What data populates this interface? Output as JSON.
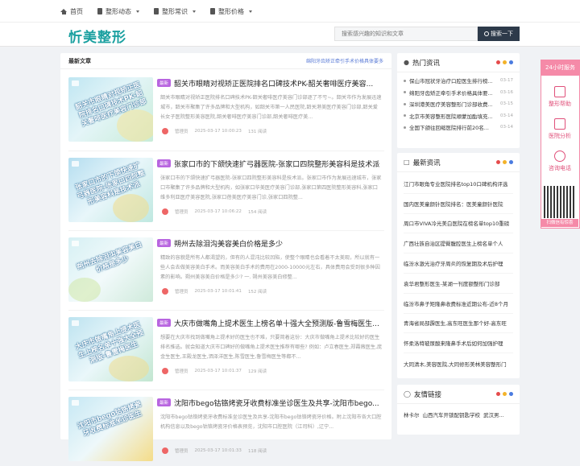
{
  "topnav": [
    {
      "label": "首页",
      "icon": "home-icon",
      "dropdown": false
    },
    {
      "label": "整形动态",
      "icon": "book-icon",
      "dropdown": true
    },
    {
      "label": "整形常识",
      "icon": "book-icon",
      "dropdown": true
    },
    {
      "label": "整形价格",
      "icon": "book-icon",
      "dropdown": true
    }
  ],
  "logo": "忻美整形",
  "search": {
    "placeholder": "搜索感兴趣的知识和文章",
    "button": "搜索一下"
  },
  "main": {
    "heading": "最新文章",
    "notice": "绵阳牙齿矫正牵引手术价格具体要多",
    "articles": [
      {
        "badge": "最新",
        "title": "韶关市眼睛对视矫正医院排名口碑技术PK-韶关奢啡医疗美容...",
        "thumb_text": "韶关市眼睛对视矫正医院排名口碑技术PK-韶关奢啡医疗美容门诊部",
        "excerpt": "韶关市眼睛对视矫正医院排名口碑技术PK-韶关奢啡医疗美容门诊部逐了不亏~。韶关市作为发展迅速城市，韶关市聚集了许多品牌和大型机构，如韶关市第一人民医院,韶关港美医疗美容门诊部,韶关爱长女子医院整形美容医院,韶关奢啡医疗美容门诊部,韶关奢啡医疗美...",
        "author": "管理员",
        "date": "2025-03-17 10:00:23",
        "views": "131 阅读"
      },
      {
        "badge": "最新",
        "title": "张家口市的下颌快速扩弓器医院-张家口四院整形美容科是技术派",
        "thumb_text": "张家口市的下颌快速扩弓器医院-张家口四院整形美容科是技术派",
        "excerpt": "张家口市的下颌快速扩弓器医院-张家口四院整形美容科是技术派。张家口市作为发展迅速城市，张家口市聚集了许多品牌和大型机构，如张家口华美医疗美容门诊部,张家口第四医院整形美容科,张家口维多利亚医疗美容医院,张家口蓓美医疗美容门诊,张家口四院整...",
        "author": "管理员",
        "date": "2025-03-17 10:06:22",
        "views": "154 阅读"
      },
      {
        "badge": "最新",
        "title": "朔州去除泪沟美容美白价格是多少",
        "thumb_text": "朔州去除泪沟美容美白价格是多少",
        "excerpt": "精致的容貌是所有人都渴望的，但有的人混沌比较凹陷，使整个眼睛也会看着不太美观，所以就有一些人会去做美容美白手术。而美容美白手术的费用在2000-10000元左右，具体费用会受到很多种因素的影响。朔州美容美白价格是多少? 一. 朔州美容美白修整...",
        "author": "管理员",
        "date": "2025-03-17 10:01:41",
        "views": "152 阅读"
      },
      {
        "badge": "最新",
        "title": "大庆市做嘴角上提术医生上榜名单十强大全预测版-鲁雪梅医生...",
        "thumb_text": "大庆市做嘴角上提术医生上榜名单十强大全预测版-鲁雪梅医生",
        "excerpt": "想要在大庆市找到做嘴角上提术好的医生也不难，只要简着这份：大庆市做嘴角上提术比较好的医生排名推选。就会知道大庆市口碑好的做嘴角上提术医生推荐有哪些? 例如：卢立春医生,郑霞薇医生,庞金生医生,王殿龙医生,洒泽洋医生,陈雪医生,鲁雪梅医生等都不...",
        "author": "管理员",
        "date": "2025-03-17 10:01:37",
        "views": "129 阅读"
      },
      {
        "badge": "最新",
        "title": "沈阳市bego钴铬烤瓷牙收费标准坐诊医生及共享-沈阳市bego...",
        "thumb_text": "沈阳市bego钴铬烤瓷牙收费标准坐诊医生",
        "excerpt": "沈阳市bego钴铬烤瓷牙收费标准坐诊医生及共享-沈阳市bego钴铬烤瓷牙价格。附上沈阳市各大口腔机构信息以及bego钴铬烤瓷牙价格表预览，沈阳市口腔医院（江司科）,辽宁...",
        "author": "管理员",
        "date": "2025-03-17 10:01:33",
        "views": "118 阅读"
      }
    ]
  },
  "hot": {
    "title": "热门资讯",
    "items": [
      {
        "text": "保山市冠状牙治疗口腔医生排行榜...",
        "date": "03-17"
      },
      {
        "text": "绵阳牙齿矫正牵引手术价格具体要...",
        "date": "03-16"
      },
      {
        "text": "深圳港美医疗美容整形门诊部收费...",
        "date": "03-15"
      },
      {
        "text": "北京市美容整形医院顺蒙加酯填充...",
        "date": "03-14"
      },
      {
        "text": "全国下颌往回缩医院排行前20名...",
        "date": "03-14"
      }
    ]
  },
  "latest": {
    "title": "最新资讯",
    "items": [
      "江门市眼角专业医院排名top10口碑机构评选",
      "国内医美童颜针医院排名：医美童颜针医院",
      "周口市VIVA冷光美白医院在榜名单top10重磅",
      "广西壮族自治区提臀腹腔医生上榜名单个人",
      "临汾水激光治疗牙周炎的恢复期及术后护理",
      "袁华君整形医生-某湖一刊度额整形门诊部",
      "临汾市鼻子矩隆鼻收费标准近期公布-近8个月",
      "青海省局部霹医生,高东旺医生那个好-高东旺",
      "怀柔洛特玻尿酸来隆鼻手术后如何加强护理",
      "大同清木,美容医院,大同修形美林美容整形门"
    ]
  },
  "friends": {
    "title": "友情链接",
    "items": [
      "林卡尔",
      "山西汽车开锁配钥匙学校",
      "武汉男..."
    ]
  },
  "float": {
    "call": "24小时服务",
    "items": [
      "整形帮助",
      "医院分析",
      "咨询电话"
    ],
    "qr_label": "扫微信有惊喜"
  },
  "colors": {
    "accent": "#1aa0a0",
    "badge": "#b865e0",
    "pink": "#f58aa8",
    "dot_red": "#e54b4b",
    "dot_yellow": "#f3b32a",
    "dot_blue": "#4a7be0"
  }
}
